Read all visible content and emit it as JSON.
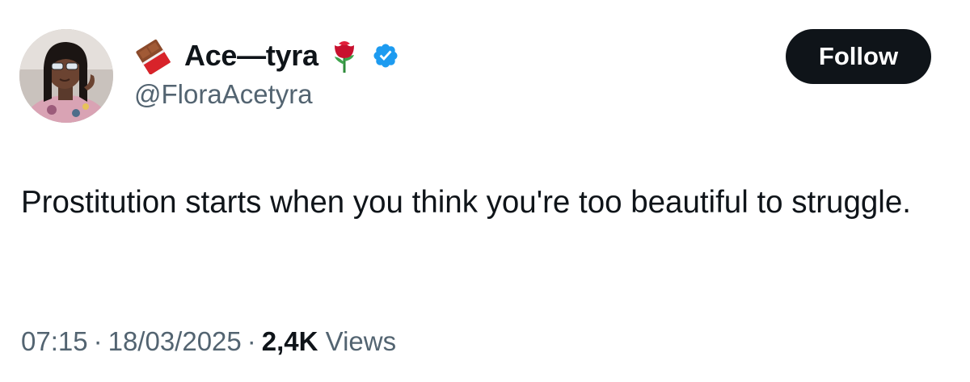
{
  "author": {
    "display_name": "Ace—tyra",
    "handle": "@FloraAcetyra",
    "name_prefix_emoji": "chocolate-bar-icon",
    "name_suffix_emoji": "rose-icon",
    "verified_badge": "verified-badge-icon",
    "verified_color": "#1d9bf0"
  },
  "follow_button": {
    "label": "Follow",
    "background": "#0f1419",
    "text_color": "#ffffff"
  },
  "tweet": {
    "text": "Prostitution starts when you think you're too beautiful to struggle."
  },
  "meta": {
    "time": "07:15",
    "separator": "·",
    "date": "18/03/2025",
    "views_count": "2,4K",
    "views_label": "Views"
  }
}
